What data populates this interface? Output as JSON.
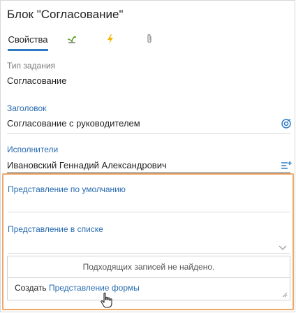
{
  "header": {
    "title": "Блок \"Согласование\""
  },
  "tabs": [
    {
      "label": "Свойства",
      "icon": "",
      "active": true
    },
    {
      "label": "",
      "icon": "plant-icon",
      "active": false
    },
    {
      "label": "",
      "icon": "lightning-icon",
      "active": false
    },
    {
      "label": "",
      "icon": "paperclip-icon",
      "active": false
    }
  ],
  "fields": {
    "task_type": {
      "label": "Тип задания",
      "value": "Согласование"
    },
    "heading": {
      "label": "Заголовок",
      "value": "Согласование с руководителем"
    },
    "performers": {
      "label": "Исполнители",
      "value": "Ивановский Геннадий Александрович"
    },
    "default_view": {
      "label": "Представление по умолчанию",
      "value": ""
    },
    "list_view": {
      "label": "Представление в списке",
      "value": ""
    }
  },
  "dropdown": {
    "not_found": "Подходящих записей не найдено.",
    "create_prefix": "Создать",
    "create_link": "Представление формы"
  },
  "colors": {
    "accent": "#2e7bc4",
    "label_blue": "#2a6cb0",
    "highlight": "#f0a868",
    "plant_green": "#5aa02c",
    "lightning_yellow": "#f4b400"
  }
}
